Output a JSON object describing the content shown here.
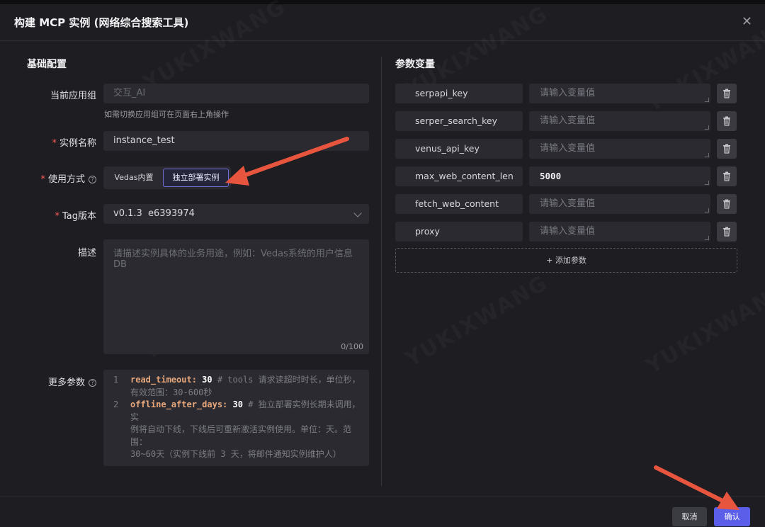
{
  "window": {
    "title": "构建 MCP 实例 (网络综合搜索工具)"
  },
  "watermark": "YUKIXWANG",
  "basic": {
    "section_title": "基础配置",
    "app_group": {
      "label": "当前应用组",
      "value": "交互_AI",
      "hint": "如需切换应用组可在页面右上角操作"
    },
    "instance_name": {
      "label": "实例名称",
      "value": "instance_test"
    },
    "usage": {
      "label": "使用方式",
      "options": [
        "Vedas内置",
        "独立部署实例"
      ],
      "selected": "独立部署实例"
    },
    "tag": {
      "label": "Tag版本",
      "value": "v0.1.3  e6393974"
    },
    "desc": {
      "label": "描述",
      "placeholder": "请描述实例具体的业务用途，例如：Vedas系统的用户信息DB",
      "counter": "0/100"
    },
    "more": {
      "label": "更多参数",
      "lines": [
        {
          "num": "1",
          "key": "read_timeout:",
          "value": "30",
          "comment": "# tools 请求读超时时长，单位秒，",
          "comment2": "有效范围：30-600秒"
        },
        {
          "num": "2",
          "key": "offline_after_days:",
          "value": "30",
          "comment": "# 独立部署实例长期未调用，实",
          "comment2": "例将自动下线，下线后可重新激活实例使用。单位：天。范围：",
          "comment3": "30~60天（实例下线前 3 天，将邮件通知实例维护人）"
        }
      ]
    }
  },
  "params": {
    "section_title": "参数变量",
    "placeholder": "请输入变量值",
    "items": [
      {
        "name": "serpapi_key",
        "value": ""
      },
      {
        "name": "serper_search_key",
        "value": ""
      },
      {
        "name": "venus_api_key",
        "value": ""
      },
      {
        "name": "max_web_content_len",
        "value": "5000"
      },
      {
        "name": "fetch_web_content",
        "value": ""
      },
      {
        "name": "proxy",
        "value": ""
      }
    ],
    "add_label": "+ 添加参数"
  },
  "footer": {
    "cancel": "取消",
    "confirm": "确认"
  },
  "colors": {
    "accent": "#5b5ee8",
    "arrow": "#e8553f",
    "required": "#ff5a5a"
  }
}
